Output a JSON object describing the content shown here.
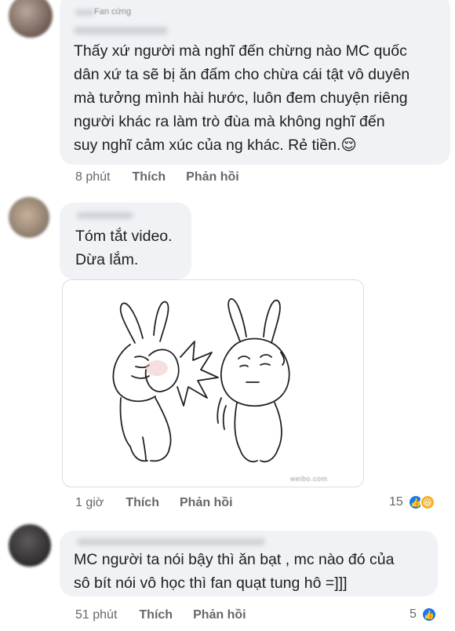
{
  "comments": [
    {
      "author": "",
      "badge": "Fan cứng",
      "text": "Thấy xứ người mà nghĩ đến chừng nào MC quốc\ndân xứ ta sẽ bị ăn đấm cho chừa cái tật vô duyên\nmà tưởng mình hài hước, luôn đem chuyện riêng\nngười khác ra làm trò đùa mà không nghĩ đến\nsuy nghĩ cảm xúc của ng khác. Rẻ tiền.😌",
      "time": "8 phút",
      "like_label": "Thích",
      "reply_label": "Phản hồi"
    },
    {
      "author": "",
      "text": "Tóm tắt video.\nDừa lắm.",
      "time": "1 giờ",
      "like_label": "Thích",
      "reply_label": "Phản hồi",
      "reaction_count": "15",
      "reactions": [
        "like",
        "haha"
      ],
      "sticker_watermark": "weibo.com"
    },
    {
      "author": "",
      "text": "MC người ta nói bậy thì ăn bạt , mc nào đó của\nsô bít nói vô học thì fan quạt tung hô =]]]",
      "time": "51 phút",
      "like_label": "Thích",
      "reply_label": "Phản hồi",
      "reaction_count": "5",
      "reactions": [
        "like"
      ]
    }
  ],
  "colors": {
    "bubble": "#f0f2f5",
    "meta_text": "#65676b",
    "like_blue": "#1877f2",
    "haha_yellow": "#f7b125"
  },
  "icons": {
    "like": "thumbs-up-icon",
    "haha": "laughing-face-icon"
  }
}
